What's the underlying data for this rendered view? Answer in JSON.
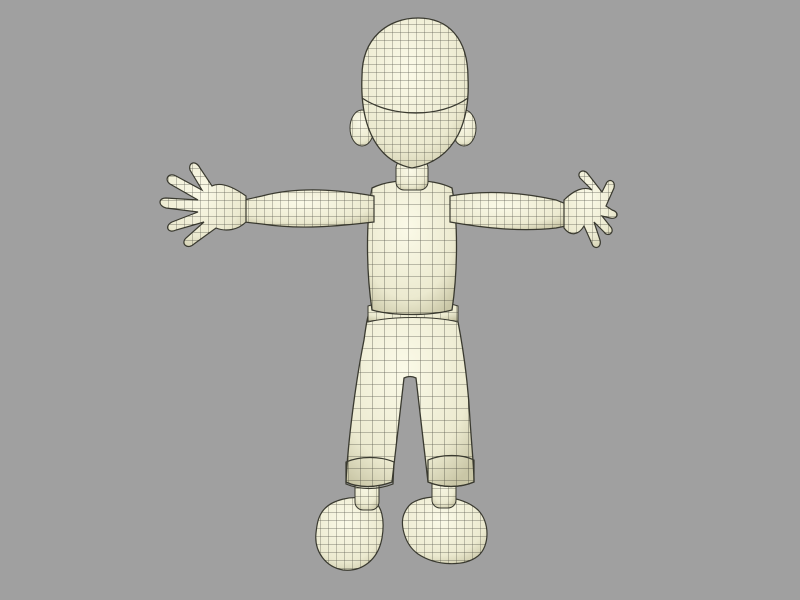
{
  "viewport": {
    "background": "#a0a0a0",
    "subject": "character-model-wireframe-back-view"
  },
  "colors": {
    "model_fill": "#f1efd4",
    "model_shade": "#d6d3b3",
    "wire": "#2b2b22",
    "outline": "#3a3a30"
  }
}
